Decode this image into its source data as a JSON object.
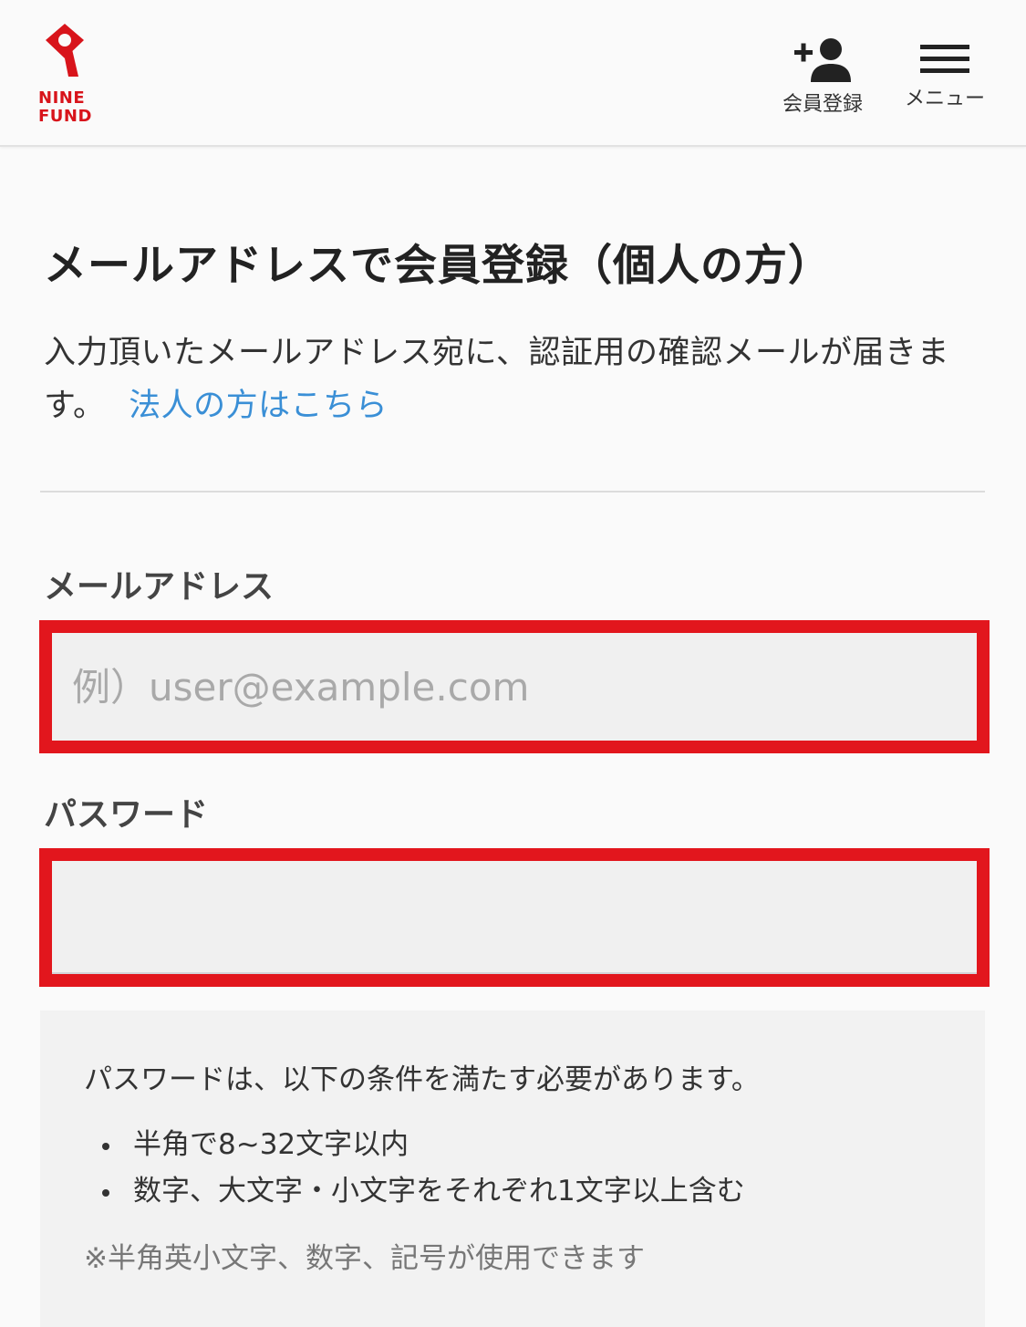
{
  "brand": {
    "name_line1": "NINE",
    "name_line2": "FUND",
    "color": "#d8141b"
  },
  "header": {
    "register_label": "会員登録",
    "register_icon": "person-add-icon",
    "menu_label": "メニュー",
    "menu_icon": "hamburger-menu-icon"
  },
  "page": {
    "title": "メールアドレスで会員登録（個人の方）",
    "description": "入力頂いたメールアドレス宛に、認証用の確認メールが届きます。",
    "corporate_link": "法人の方はこちら",
    "link_color": "#3a8fd6"
  },
  "form": {
    "email_label": "メールアドレス",
    "email_placeholder": "例）user@example.com",
    "email_value": "",
    "password_label": "パスワード",
    "password_value": "",
    "highlight_color": "#e2161d"
  },
  "password_rules": {
    "intro": "パスワードは、以下の条件を満たす必要があります。",
    "items": [
      "半角で8~32文字以内",
      "数字、大文字・小文字をそれぞれ1文字以上含む"
    ],
    "note": "※半角英小文字、数字、記号が使用できます"
  }
}
